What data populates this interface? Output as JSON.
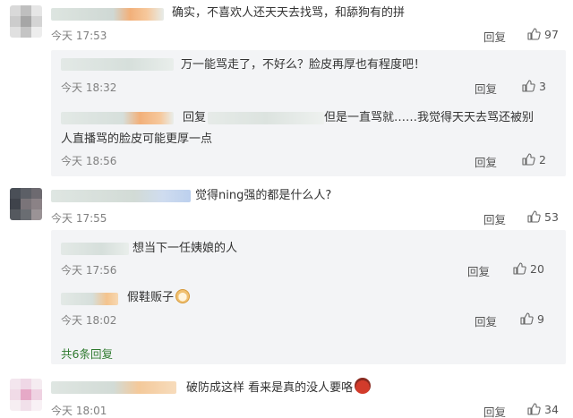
{
  "comments": [
    {
      "text": "确实，不喜欢人还天天去找骂，和舔狗有的拼",
      "time": "今天 17:53",
      "reply_label": "回复",
      "likes": "97",
      "replies": [
        {
          "text": "万一能骂走了，不好么？脸皮再厚也有程度吧！",
          "time": "今天 18:32",
          "reply_label": "回复",
          "likes": "3"
        },
        {
          "reply_prefix": "回复",
          "text_line1": "但是一直骂就……我觉得天天去骂还被别",
          "text_line2": "人直播骂的脸皮可能更厚一点",
          "time": "今天 18:56",
          "reply_label": "回复",
          "likes": "2"
        }
      ]
    },
    {
      "text": "觉得ning强的都是什么人?",
      "time": "今天 17:55",
      "reply_label": "回复",
      "likes": "53",
      "replies": [
        {
          "text": "想当下一任姨娘的人",
          "time": "今天 17:56",
          "reply_label": "回复",
          "likes": "20"
        },
        {
          "text": "假鞋贩子",
          "emoji": "dog-face-emoji",
          "time": "今天 18:02",
          "reply_label": "回复",
          "likes": "9"
        }
      ],
      "more_replies": "共6条回复"
    },
    {
      "text": "破防成这样 看来是真的没人要咯",
      "emoji": "sweat-emoji",
      "time": "今天 18:01",
      "reply_label": "回复",
      "likes": "34"
    }
  ],
  "icons": {
    "like": "thumbs-up-icon"
  },
  "colors": {
    "sub_background": "#f3f4f6",
    "more_link": "#2f7a2f",
    "meta_text": "#808080"
  }
}
